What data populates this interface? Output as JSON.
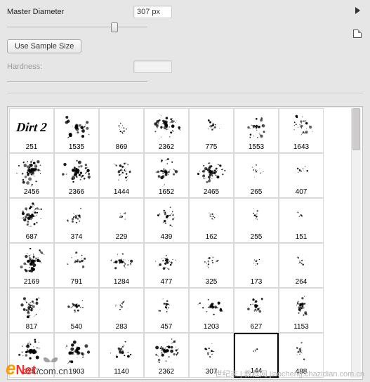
{
  "header": {
    "master_diameter_label": "Master Diameter",
    "master_diameter_value": "307 px",
    "use_sample_size_label": "Use Sample Size",
    "hardness_label": "Hardness:",
    "hardness_value": "",
    "slider_master_pos_pct": 78
  },
  "selected_index": 40,
  "presets": [
    {
      "label": "251",
      "seed": 1,
      "density": 10,
      "size": 0.85,
      "logo": true,
      "logo_text": "Dirt 2"
    },
    {
      "label": "1535",
      "seed": 2,
      "density": 26,
      "size": 1.0
    },
    {
      "label": "869",
      "seed": 3,
      "density": 14,
      "size": 0.5
    },
    {
      "label": "2362",
      "seed": 4,
      "density": 40,
      "size": 1.0
    },
    {
      "label": "775",
      "seed": 5,
      "density": 14,
      "size": 0.6
    },
    {
      "label": "1553",
      "seed": 6,
      "density": 22,
      "size": 0.9
    },
    {
      "label": "1643",
      "seed": 7,
      "density": 24,
      "size": 0.9
    },
    {
      "label": "2456",
      "seed": 8,
      "density": 52,
      "size": 1.0
    },
    {
      "label": "2366",
      "seed": 9,
      "density": 48,
      "size": 1.0
    },
    {
      "label": "1444",
      "seed": 10,
      "density": 22,
      "size": 0.8
    },
    {
      "label": "1652",
      "seed": 11,
      "density": 28,
      "size": 0.9
    },
    {
      "label": "2465",
      "seed": 12,
      "density": 46,
      "size": 1.0
    },
    {
      "label": "265",
      "seed": 13,
      "density": 10,
      "size": 0.45
    },
    {
      "label": "407",
      "seed": 14,
      "density": 12,
      "size": 0.55
    },
    {
      "label": "687",
      "seed": 15,
      "density": 36,
      "size": 0.9
    },
    {
      "label": "374",
      "seed": 16,
      "density": 20,
      "size": 0.7
    },
    {
      "label": "229",
      "seed": 17,
      "density": 10,
      "size": 0.45
    },
    {
      "label": "439",
      "seed": 18,
      "density": 20,
      "size": 0.7
    },
    {
      "label": "162",
      "seed": 19,
      "density": 10,
      "size": 0.4
    },
    {
      "label": "255",
      "seed": 20,
      "density": 12,
      "size": 0.5
    },
    {
      "label": "151",
      "seed": 21,
      "density": 8,
      "size": 0.4
    },
    {
      "label": "2169",
      "seed": 22,
      "density": 42,
      "size": 1.0
    },
    {
      "label": "791",
      "seed": 23,
      "density": 18,
      "size": 0.7
    },
    {
      "label": "1284",
      "seed": 24,
      "density": 26,
      "size": 0.85
    },
    {
      "label": "477",
      "seed": 25,
      "density": 28,
      "size": 0.75
    },
    {
      "label": "325",
      "seed": 26,
      "density": 16,
      "size": 0.55
    },
    {
      "label": "173",
      "seed": 27,
      "density": 10,
      "size": 0.45
    },
    {
      "label": "264",
      "seed": 28,
      "density": 12,
      "size": 0.5
    },
    {
      "label": "817",
      "seed": 29,
      "density": 32,
      "size": 0.85
    },
    {
      "label": "540",
      "seed": 30,
      "density": 22,
      "size": 0.7
    },
    {
      "label": "283",
      "seed": 31,
      "density": 14,
      "size": 0.5
    },
    {
      "label": "457",
      "seed": 32,
      "density": 18,
      "size": 0.6
    },
    {
      "label": "1203",
      "seed": 33,
      "density": 30,
      "size": 0.85
    },
    {
      "label": "627",
      "seed": 34,
      "density": 20,
      "size": 0.7
    },
    {
      "label": "1153",
      "seed": 35,
      "density": 26,
      "size": 0.8
    },
    {
      "label": "2287",
      "seed": 36,
      "density": 40,
      "size": 1.0
    },
    {
      "label": "1903",
      "seed": 37,
      "density": 34,
      "size": 0.95
    },
    {
      "label": "1140",
      "seed": 38,
      "density": 24,
      "size": 0.8
    },
    {
      "label": "2362",
      "seed": 39,
      "density": 38,
      "size": 0.95
    },
    {
      "label": "307",
      "seed": 40,
      "density": 14,
      "size": 0.55
    },
    {
      "label": "144",
      "seed": 41,
      "density": 8,
      "size": 0.4
    },
    {
      "label": "488",
      "seed": 42,
      "density": 18,
      "size": 0.6
    }
  ],
  "watermark": {
    "left_e": "e",
    "left_net": "Net",
    "left_com": ".com.cn",
    "right": "世纪末 | 教程网  jiaocheng.chazidian.com.cn"
  }
}
